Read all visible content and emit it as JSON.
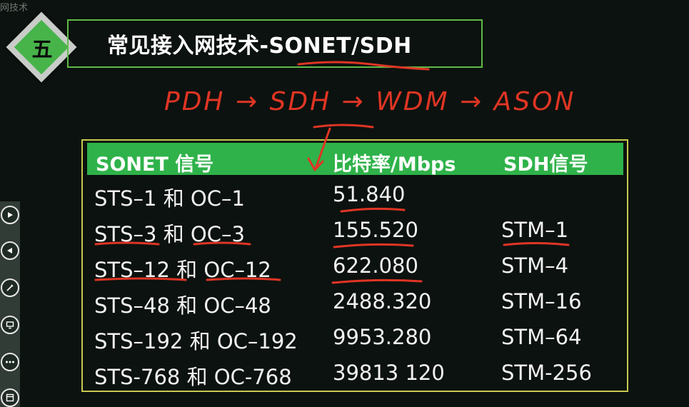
{
  "page": {
    "caption": "网技术"
  },
  "section": {
    "badge": "五",
    "title": "常见接入网技术-SONET/SDH"
  },
  "annotation": {
    "handwriting": "PDH → SDH → WDM → ASON"
  },
  "table": {
    "headers": [
      "SONET 信号",
      "比特率/Mbps",
      "SDH信号"
    ],
    "rows": [
      [
        "STS–1 和 OC–1",
        "51.840",
        ""
      ],
      [
        "STS–3 和 OC–3",
        "155.520",
        "STM–1"
      ],
      [
        "STS–12 和 OC–12",
        "622.080",
        "STM–4"
      ],
      [
        "STS–48 和 OC–48",
        "2488.320",
        "STM–16"
      ],
      [
        "STS–192 和 OC–192",
        "9953.280",
        "STM–64"
      ],
      [
        "STS-768 和 OC-768",
        "39813 120",
        "STM-256"
      ]
    ]
  },
  "toolbar": {
    "buttons": [
      {
        "icon": "play-forward-icon"
      },
      {
        "icon": "play-back-icon"
      },
      {
        "icon": "pen-icon"
      },
      {
        "icon": "screen-icon"
      },
      {
        "icon": "more-icon"
      },
      {
        "icon": "window-icon"
      }
    ]
  },
  "colors": {
    "background": "#0c120f",
    "accent_green": "#2fb24a",
    "table_border": "#c7c94e",
    "title_border": "#5fbb49",
    "annotation_red": "#e03524"
  }
}
